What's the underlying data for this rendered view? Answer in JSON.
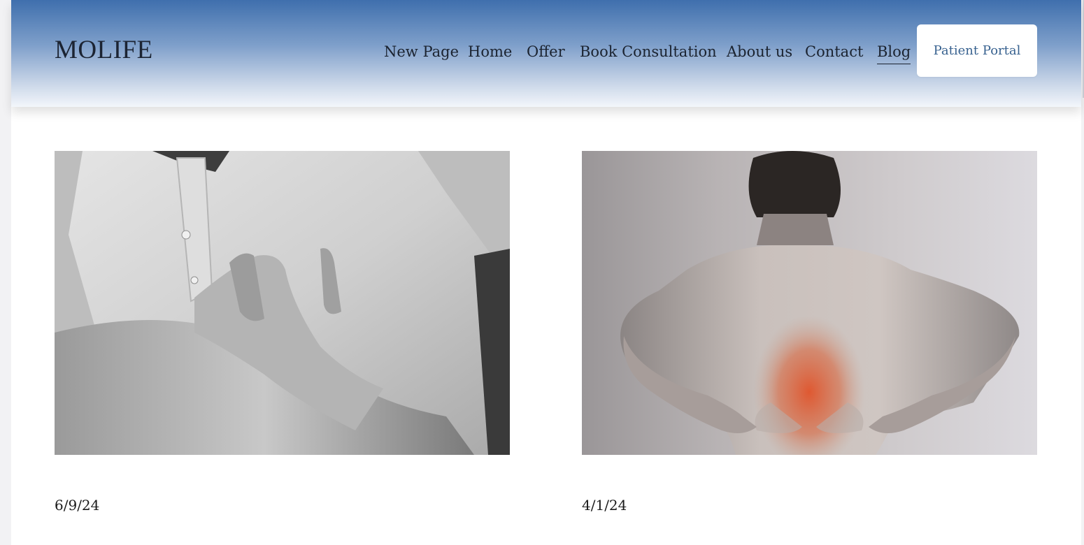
{
  "header": {
    "logo": "MOLIFE",
    "nav": [
      {
        "label": "New Page"
      },
      {
        "label": "Home"
      },
      {
        "label": "Offer"
      },
      {
        "label": "Book Consultation"
      },
      {
        "label": "About us"
      },
      {
        "label": "Contact"
      },
      {
        "label": "Blog",
        "active": true
      }
    ],
    "portal_button": "Patient Portal"
  },
  "posts": [
    {
      "date": "6/9/24",
      "image": "man-clutching-chest-photo"
    },
    {
      "date": "4/1/24",
      "image": "man-back-pain-photo"
    }
  ],
  "colors": {
    "header_top": "#3f6fad",
    "header_bottom": "#f3f6fb",
    "portal_text": "#37618f",
    "text": "#1b2330",
    "pain_highlight": "#e0532a"
  }
}
